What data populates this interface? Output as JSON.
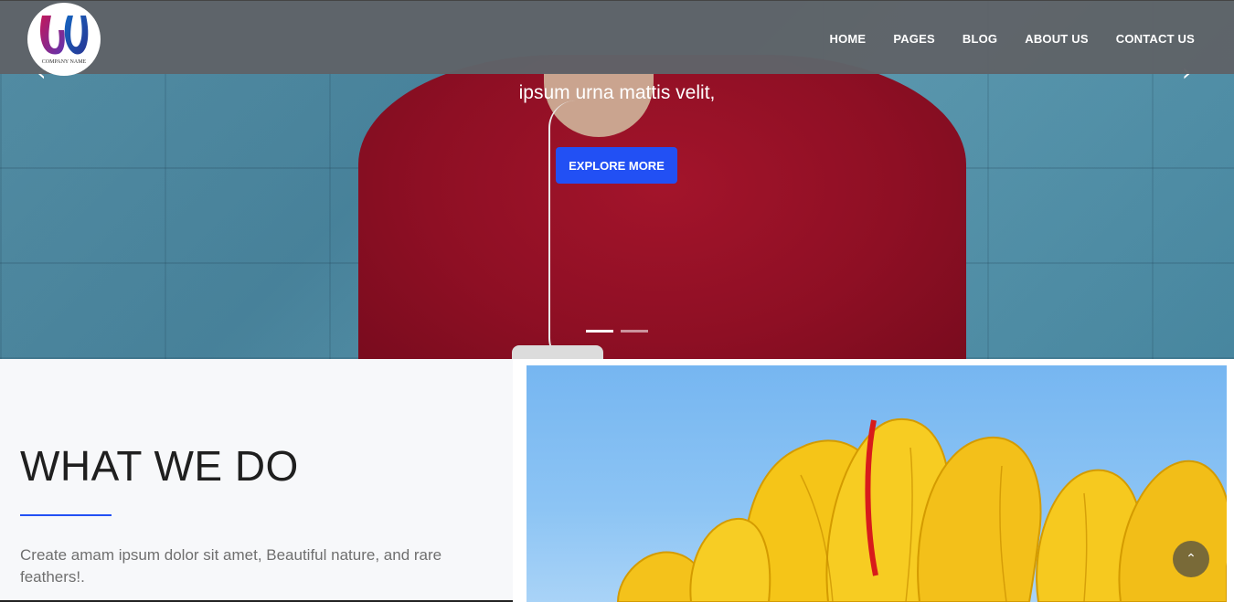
{
  "header": {
    "logo_text": "COMPANY NAME",
    "nav": [
      {
        "label": "HOME"
      },
      {
        "label": "PAGES"
      },
      {
        "label": "BLOG"
      },
      {
        "label": "ABOUT US"
      },
      {
        "label": "CONTACT US"
      }
    ]
  },
  "hero": {
    "tagline": "ipsum urna mattis velit,",
    "button_label": "EXPLORE MORE",
    "prev_icon": "chevron-left-icon",
    "next_icon": "chevron-right-icon",
    "slides_count": 2,
    "active_slide": 1
  },
  "about": {
    "title": "WHAT WE DO",
    "description": "Create amam ipsum dolor sit amet, Beautiful nature, and rare feathers!."
  },
  "scroll_top_icon": "chevron-up-icon",
  "colors": {
    "accent": "#2250f4",
    "navbar": "#5f6368",
    "title": "#1f1f1f",
    "text": "#6f6f6f"
  }
}
